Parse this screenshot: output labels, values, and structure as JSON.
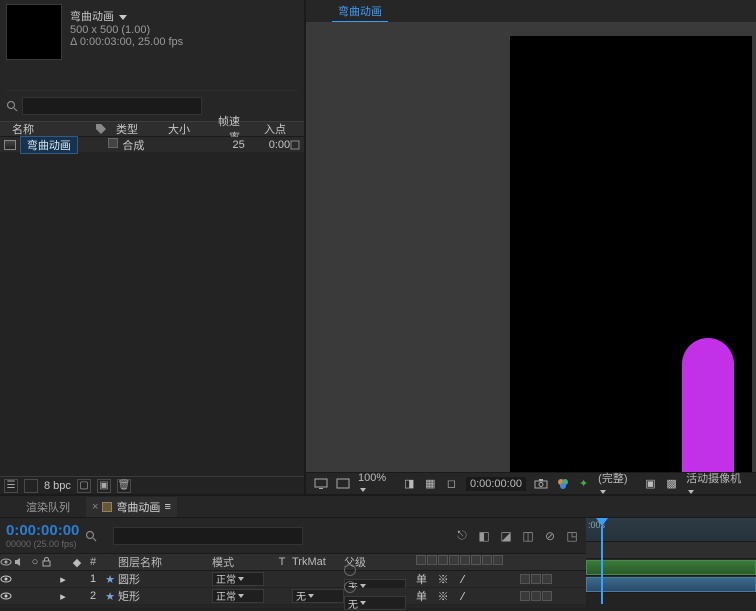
{
  "project": {
    "item_name": "弯曲动画",
    "dimensions": "500 x 500 (1.00)",
    "duration": "0:00:03:00, 25.00 fps",
    "delta_prefix": "Δ",
    "columns": {
      "name": "名称",
      "type": "类型",
      "size": "大小",
      "rate": "帧速率",
      "in": "入点"
    },
    "row": {
      "name": "弯曲动画",
      "type": "合成",
      "rate": "25",
      "in": "0:00"
    },
    "bpc": "8 bpc"
  },
  "comp": {
    "tab_name": "弯曲动画",
    "zoom": "100%",
    "time": "0:00:00:00",
    "res": "(完整)",
    "camera": "活动摄像机"
  },
  "timeline": {
    "tabs": {
      "render_queue": "渲染队列",
      "comp": "弯曲动画"
    },
    "time": "0:00:00:00",
    "subtime": "00000 (25.00 fps)",
    "ruler_start": ":00s",
    "columns": {
      "num": "#",
      "layer_name": "图层名称",
      "mode": "模式",
      "t": "T",
      "trkmat": "TrkMat",
      "parent": "父级",
      "switches_head": "单 ※ ヽ fx 圓 ⊘ ⊘ ⊙"
    },
    "layers": [
      {
        "num": "1",
        "name": "圆形",
        "mode": "正常",
        "trk": "",
        "parent": "无",
        "switches": "单 ※ /"
      },
      {
        "num": "2",
        "name": "矩形",
        "mode": "正常",
        "trk": "无",
        "parent": "无",
        "switches": "单 ※ /"
      }
    ]
  }
}
